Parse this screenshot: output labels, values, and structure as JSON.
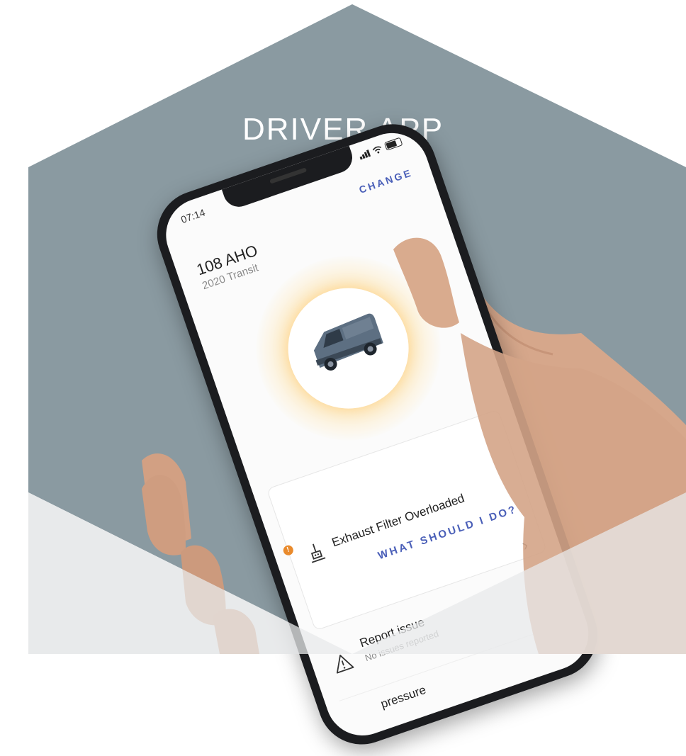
{
  "title": "DRIVER APP",
  "colors": {
    "hexagon_top": "#8a9aa1",
    "hexagon_bottom": "#e8eaeb",
    "accent": "#4a5fb8",
    "warning": "#e98a2c"
  },
  "phone": {
    "status_time": "07:14",
    "change_label": "CHANGE",
    "vehicle_id": "108 AHO",
    "vehicle_model": "2020 Transit",
    "alert": {
      "badge": "!",
      "title": "Exhaust Filter Overloaded",
      "action": "WHAT SHOULD I DO?",
      "icon": "exhaust-filter-icon"
    },
    "report": {
      "title": "Report issue",
      "subtitle": "No issues reported",
      "icon": "warning-triangle-icon"
    },
    "partial_row_label": "pressure"
  }
}
